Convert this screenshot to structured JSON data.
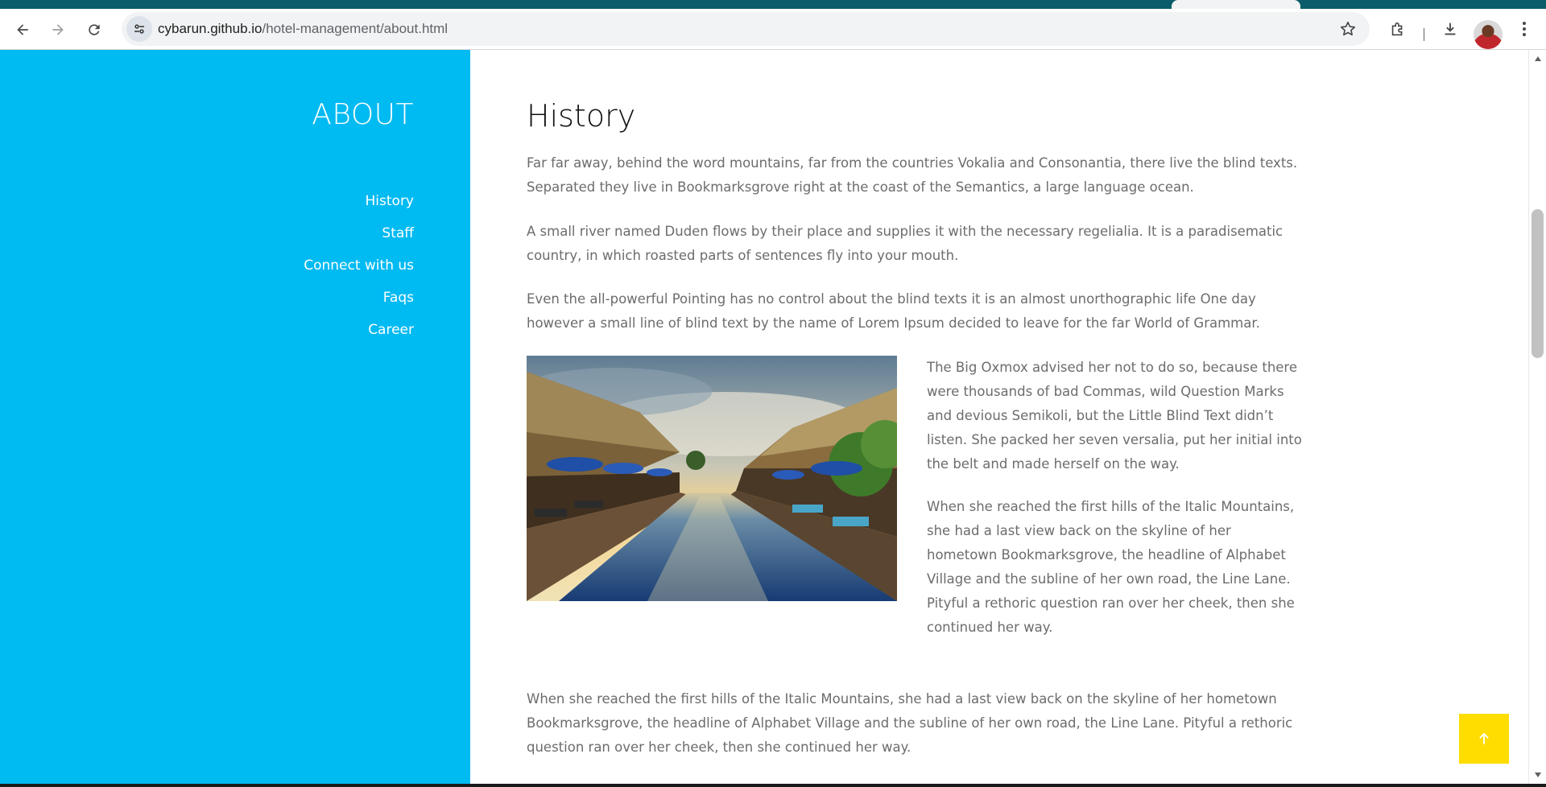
{
  "browser": {
    "url_host": "cybarun.github.io",
    "url_path": "/hotel-management/about.html",
    "icons": {
      "back": "back-arrow-icon",
      "forward": "forward-arrow-icon",
      "reload": "reload-icon",
      "site_info": "tune-icon",
      "bookmark": "star-icon",
      "extensions": "puzzle-icon",
      "downloads": "download-icon",
      "menu": "kebab-menu-icon"
    }
  },
  "sidebar": {
    "title": "ABOUT",
    "background": "#00baf2",
    "items": [
      {
        "label": "History"
      },
      {
        "label": "Staff"
      },
      {
        "label": "Connect with us"
      },
      {
        "label": "Faqs"
      },
      {
        "label": "Career"
      }
    ]
  },
  "main": {
    "heading": "History",
    "paragraphs": [
      "Far far away, behind the word mountains, far from the countries Vokalia and Consonantia, there live the blind texts. Separated they live in Bookmarksgrove right at the coast of the Semantics, a large language ocean.",
      "A small river named Duden flows by their place and supplies it with the necessary regelialia. It is a paradisematic country, in which roasted parts of sentences fly into your mouth.",
      "Even the all-powerful Pointing has no control about the blind texts it is an almost unorthographic life One day however a small line of blind text by the name of Lorem Ipsum decided to leave for the far World of Grammar.",
      "The Big Oxmox advised her not to do so, because there were thousands of bad Commas, wild Question Marks and devious Semikoli, but the Little Blind Text didn’t listen. She packed her seven versalia, put her initial into the belt and made herself on the way.",
      "When she reached the first hills of the Italic Mountains, she had a last view back on the skyline of her hometown Bookmarksgrove, the headline of Alphabet Village and the subline of her own road, the Line Lane. Pityful a rethoric question ran over her cheek, then she continued her way.",
      "When she reached the first hills of the Italic Mountains, she had a last view back on the skyline of her hometown Bookmarksgrove, the headline of Alphabet Village and the subline of her own road, the Line Lane. Pityful a rethoric question ran over her cheek, then she continued her way."
    ],
    "image": "resort-pool-photo"
  },
  "back_to_top": {
    "icon": "arrow-up-icon",
    "color": "#ffdd00"
  }
}
